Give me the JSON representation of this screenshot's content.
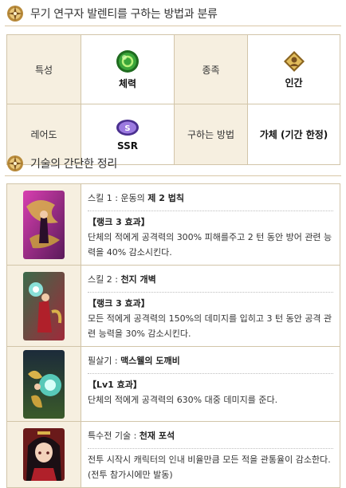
{
  "sections": {
    "method_title": "무기 연구자 발렌티를 구하는 방법과 분류",
    "skills_title": "기술의 간단한 정리"
  },
  "info": {
    "trait_label": "특성",
    "trait_value": "체력",
    "race_label": "종족",
    "race_value": "인간",
    "rarity_label": "레어도",
    "rarity_value": "SSR",
    "obtain_label": "구하는 방법",
    "obtain_value": "가체 (기간 한정)"
  },
  "skills": [
    {
      "name_prefix": "스킬 1 : 운동의 ",
      "name_bold": "제 2 법칙",
      "rank": "【랭크 3 효과】",
      "text": "단체의 적에게 공격력의 300% 피해를주고 2 턴 동안 방어 관련 능력을 40% 감소시킨다."
    },
    {
      "name_prefix": "스킬 2 : ",
      "name_bold": "천지 개벽",
      "rank": "【랭크 3 효과】",
      "text": "모든 적에게 공격력의 150%의 데미지를 입히고 3 턴 동안 공격 관련 능력을 30% 감소시킨다."
    },
    {
      "name_prefix": "필살기 : ",
      "name_bold": "맥스웰의 도깨비",
      "rank": "【Lv1 효과】",
      "text": "단체의 적에게 공격력의 630% 대중 데미지를 준다."
    },
    {
      "name_prefix": "특수전 기술 : ",
      "name_bold": "천재 포석",
      "rank": "",
      "text": "전투 시작시 캐릭터의 인내 비율만큼 모든 적을 관통율이 감소한다. (전투 참가시에만 발동)"
    }
  ],
  "colors": {
    "label_bg": "#f6efe0",
    "border": "#d2c5a9",
    "trait_green": "#3aa63a",
    "race_gold": "#c9a13b",
    "rarity_purple": "#7a55c8"
  },
  "icons": {
    "section": "compass-emblem-icon",
    "trait": "stamina-green-orb-icon",
    "race": "human-race-badge-icon",
    "rarity": "ssr-rarity-icon"
  }
}
